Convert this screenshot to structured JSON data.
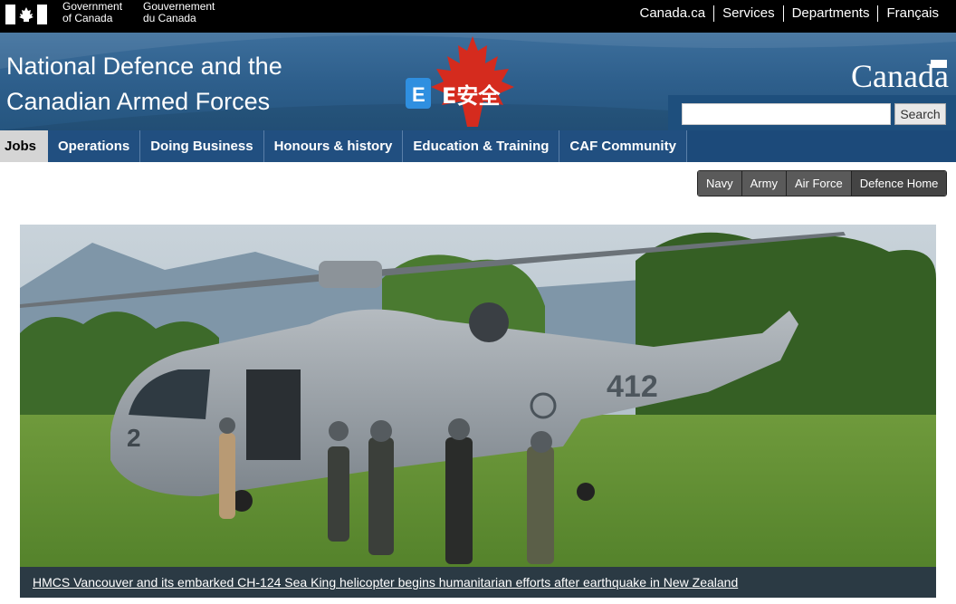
{
  "header": {
    "gov_en_line1": "Government",
    "gov_en_line2": "of Canada",
    "gov_fr_line1": "Gouvernement",
    "gov_fr_line2": "du Canada",
    "links": [
      "Canada.ca",
      "Services",
      "Departments",
      "Français"
    ]
  },
  "banner": {
    "title_line1": "National Defence and the",
    "title_line2": "Canadian Armed Forces",
    "esafety_text": "E安全",
    "esafety_letter": "E",
    "wordmark": "Canada"
  },
  "search": {
    "value": "",
    "button_label": "Search"
  },
  "nav": {
    "items": [
      "Jobs",
      "Operations",
      "Doing Business",
      "Honours & history",
      "Education & Training",
      "CAF Community"
    ]
  },
  "branches": [
    "Navy",
    "Army",
    "Air Force",
    "Defence Home"
  ],
  "hero": {
    "caption": "HMCS Vancouver and its embarked CH-124 Sea King helicopter begins humanitarian efforts after earthquake in New Zealand",
    "tail_number": "412",
    "nose_number": "2"
  },
  "colors": {
    "banner_blue": "#2e5f8c",
    "nav_blue": "#214f80",
    "maple_red": "#d52b1e"
  }
}
